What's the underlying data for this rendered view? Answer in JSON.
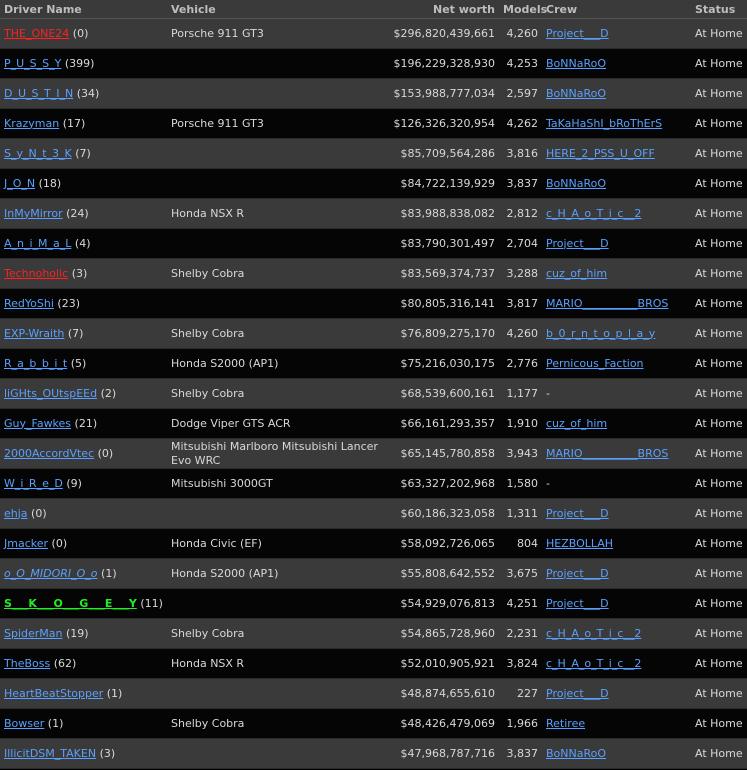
{
  "headers": {
    "driver": "Driver Name",
    "vehicle": "Vehicle",
    "networth": "Net worth",
    "models": "Models",
    "crew": "Crew",
    "status": "Status"
  },
  "rows": [
    {
      "driver": "THE_ONE24",
      "count": "(0)",
      "style": "red",
      "vehicle": "Porsche 911 GT3",
      "networth": "$296,820,439,661",
      "models": "4,260",
      "crew": "Project___D",
      "crew_link": true,
      "status": "At Home"
    },
    {
      "driver": "P_U_S_S_Y",
      "count": "(399)",
      "style": "normal",
      "vehicle": "",
      "networth": "$196,229,328,930",
      "models": "4,253",
      "crew": "BoNNaRoO",
      "crew_link": true,
      "status": "At Home"
    },
    {
      "driver": "D_U_S_T_I_N",
      "count": "(34)",
      "style": "normal",
      "vehicle": "",
      "networth": "$153,988,777,034",
      "models": "2,597",
      "crew": "BoNNaRoO",
      "crew_link": true,
      "status": "At Home"
    },
    {
      "driver": "Krazyman",
      "count": "(17)",
      "style": "normal",
      "vehicle": "Porsche 911 GT3",
      "networth": "$126,326,320,954",
      "models": "4,262",
      "crew": "TaKaHaShI_bRoThErS",
      "crew_link": true,
      "status": "At Home"
    },
    {
      "driver": "S_y_N_t_3_K",
      "count": "(7)",
      "style": "normal",
      "vehicle": "",
      "networth": "$85,709,564,286",
      "models": "3,816",
      "crew": "HERE_2_PSS_U_OFF",
      "crew_link": true,
      "status": "At Home"
    },
    {
      "driver": "J_O_N",
      "count": "(18)",
      "style": "normal",
      "vehicle": "",
      "networth": "$84,722,139,929",
      "models": "3,837",
      "crew": "BoNNaRoO",
      "crew_link": true,
      "status": "At Home"
    },
    {
      "driver": "InMyMirror",
      "count": "(24)",
      "style": "normal",
      "vehicle": "Honda NSX R",
      "networth": "$83,988,838,082",
      "models": "2,812",
      "crew": "c_H_A_o_T_i_c__2",
      "crew_link": true,
      "status": "At Home"
    },
    {
      "driver": "A_n_i_M_a_L",
      "count": "(4)",
      "style": "normal",
      "vehicle": "",
      "networth": "$83,790,301,497",
      "models": "2,704",
      "crew": "Project___D",
      "crew_link": true,
      "status": "At Home"
    },
    {
      "driver": "Technoholic",
      "count": "(3)",
      "style": "red",
      "vehicle": "Shelby Cobra",
      "networth": "$83,569,374,737",
      "models": "3,288",
      "crew": "cuz_of_him",
      "crew_link": true,
      "status": "At Home"
    },
    {
      "driver": "RedYoShi",
      "count": "(23)",
      "style": "normal",
      "vehicle": "",
      "networth": "$80,805,316,141",
      "models": "3,817",
      "crew": "MARIO__________BROS",
      "crew_link": true,
      "status": "At Home"
    },
    {
      "driver": "EXP-Wraith",
      "count": "(7)",
      "style": "normal",
      "vehicle": "Shelby Cobra",
      "networth": "$76,809,275,170",
      "models": "4,260",
      "crew": "b_0_r_n_t_o_p_l_a_y",
      "crew_link": true,
      "status": "At Home"
    },
    {
      "driver": "R_a_b_b_i_t",
      "count": "(5)",
      "style": "normal",
      "vehicle": "Honda S2000 (AP1)",
      "networth": "$75,216,030,175",
      "models": "2,776",
      "crew": "Pernicous_Faction",
      "crew_link": true,
      "status": "At Home"
    },
    {
      "driver": "liGHts_OUtspEEd",
      "count": "(2)",
      "style": "normal",
      "vehicle": "Shelby Cobra",
      "networth": "$68,539,600,161",
      "models": "1,177",
      "crew": "-",
      "crew_link": false,
      "status": "At Home"
    },
    {
      "driver": "Guy_Fawkes",
      "count": "(21)",
      "style": "normal",
      "vehicle": "Dodge Viper GTS ACR",
      "networth": "$66,161,293,357",
      "models": "1,910",
      "crew": "cuz_of_him",
      "crew_link": true,
      "status": "At Home"
    },
    {
      "driver": "2000AccordVtec",
      "count": "(0)",
      "style": "normal",
      "vehicle": "Mitsubishi Marlboro Mitsubishi Lancer Evo WRC",
      "networth": "$65,145,780,858",
      "models": "3,943",
      "crew": "MARIO__________BROS",
      "crew_link": true,
      "status": "At Home"
    },
    {
      "driver": "W_i_R_e_D",
      "count": "(9)",
      "style": "normal",
      "vehicle": "Mitsubishi 3000GT",
      "networth": "$63,327,202,968",
      "models": "1,580",
      "crew": "-",
      "crew_link": false,
      "status": "At Home"
    },
    {
      "driver": "ehja",
      "count": "(0)",
      "style": "normal",
      "vehicle": "",
      "networth": "$60,186,323,058",
      "models": "1,311",
      "crew": "Project___D",
      "crew_link": true,
      "status": "At Home"
    },
    {
      "driver": "Jmacker",
      "count": "(0)",
      "style": "normal",
      "vehicle": "Honda Civic (EF)",
      "networth": "$58,092,726,065",
      "models": "804",
      "crew": "HEZBOLLAH",
      "crew_link": true,
      "status": "At Home"
    },
    {
      "driver": "o_O_MIDORI_O_o",
      "count": "(1)",
      "style": "italic",
      "vehicle": "Honda S2000 (AP1)",
      "networth": "$55,808,642,552",
      "models": "3,675",
      "crew": "Project___D",
      "crew_link": true,
      "status": "At Home"
    },
    {
      "driver": "S___K___O___G___E___Y",
      "count": "(11)",
      "style": "green",
      "vehicle": "",
      "networth": "$54,929,076,813",
      "models": "4,251",
      "crew": "Project___D",
      "crew_link": true,
      "status": "At Home"
    },
    {
      "driver": "SpiderMan",
      "count": "(19)",
      "style": "normal",
      "vehicle": "Shelby Cobra",
      "networth": "$54,865,728,960",
      "models": "2,231",
      "crew": "c_H_A_o_T_i_c__2",
      "crew_link": true,
      "status": "At Home"
    },
    {
      "driver": "TheBoss",
      "count": "(62)",
      "style": "normal",
      "vehicle": "Honda NSX R",
      "networth": "$52,010,905,921",
      "models": "3,824",
      "crew": "c_H_A_o_T_i_c__2",
      "crew_link": true,
      "status": "At Home"
    },
    {
      "driver": "HeartBeatStopper",
      "count": "(1)",
      "style": "normal",
      "vehicle": "",
      "networth": "$48,874,655,610",
      "models": "227",
      "crew": "Project___D",
      "crew_link": true,
      "status": "At Home"
    },
    {
      "driver": "Bowser",
      "count": "(1)",
      "style": "normal",
      "vehicle": "Shelby Cobra",
      "networth": "$48,426,479,069",
      "models": "1,966",
      "crew": "Retiree",
      "crew_link": true,
      "status": "At Home"
    },
    {
      "driver": "IllicitDSM_TAKEN",
      "count": "(3)",
      "style": "normal",
      "vehicle": "",
      "networth": "$47,968,787,716",
      "models": "3,837",
      "crew": "BoNNaRoO",
      "crew_link": true,
      "status": "At Home"
    }
  ]
}
